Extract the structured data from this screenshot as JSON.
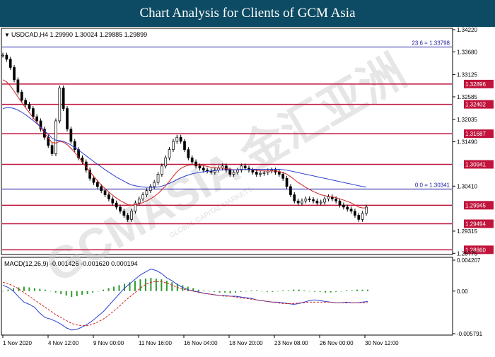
{
  "banner": {
    "title": "Chart Analysis for Clients of GCM Asia"
  },
  "chart_header": {
    "symbol_line": "USDCAD,H4  1.29990 1.30024 1.29885 1.29899",
    "menu_icon": "triangle-down-icon"
  },
  "macd_header": {
    "text": "MACD(12,26,9) -0.001426 -0.001620 0.000194"
  },
  "watermark": {
    "text": "GCMASIA 金汇亚洲",
    "subtext": "GLOBAL CAPITAL MARKETS"
  },
  "chart_data": [
    {
      "type": "candlestick",
      "title": "USDCAD,H4",
      "ylim": [
        1.2878,
        1.3422
      ],
      "y_ticks": [
        "1.34220",
        "1.33680",
        "1.33125",
        "1.32585",
        "1.32035",
        "1.31490",
        "1.30410",
        "1.29315",
        "1.28775"
      ],
      "x_ticks": [
        "1 Nov 2020",
        "4 Nov 12:00",
        "9 Nov 00:00",
        "11 Nov 16:00",
        "16 Nov 04:00",
        "18 Nov 20:00",
        "23 Nov 08:00",
        "26 Nov 00:00",
        "30 Nov 12:00"
      ],
      "levels": [
        {
          "label": "1.32896",
          "value": 1.32896,
          "color": "#c0143c"
        },
        {
          "label": "1.32402",
          "value": 1.32402,
          "color": "#c0143c"
        },
        {
          "label": "1.31687",
          "value": 1.31687,
          "color": "#c0143c"
        },
        {
          "label": "1.30941",
          "value": 1.30941,
          "color": "#c0143c"
        },
        {
          "label": "1.29945",
          "value": 1.29945,
          "color": "#c0143c"
        },
        {
          "label": "1.29494",
          "value": 1.29494,
          "color": "#c0143c"
        },
        {
          "label": "1.28860",
          "value": 1.2886,
          "color": "#c0143c"
        }
      ],
      "fib_lines": [
        {
          "label": "23.6 = 1.33798",
          "value": 1.33798,
          "color": "#1a1aa0"
        },
        {
          "label": "0.0 = 1.30341",
          "value": 1.30341,
          "color": "#1a1aa0"
        }
      ],
      "series": [
        {
          "name": "price",
          "color": "#000000",
          "values": [
            1.336,
            1.335,
            1.333,
            1.33,
            1.327,
            1.325,
            1.324,
            1.323,
            1.321,
            1.32,
            1.318,
            1.316,
            1.314,
            1.312,
            1.32,
            1.328,
            1.323,
            1.318,
            1.315,
            1.313,
            1.311,
            1.31,
            1.308,
            1.306,
            1.305,
            1.304,
            1.303,
            1.302,
            1.301,
            1.3,
            1.299,
            1.298,
            1.297,
            1.296,
            1.298,
            1.3,
            1.301,
            1.302,
            1.303,
            1.304,
            1.305,
            1.307,
            1.309,
            1.311,
            1.313,
            1.315,
            1.316,
            1.315,
            1.313,
            1.311,
            1.31,
            1.309,
            1.3085,
            1.308,
            1.3078,
            1.3075,
            1.308,
            1.3085,
            1.309,
            1.308,
            1.307,
            1.3075,
            1.308,
            1.309,
            1.3085,
            1.308,
            1.3075,
            1.307,
            1.3072,
            1.3074,
            1.3078,
            1.308,
            1.3075,
            1.307,
            1.306,
            1.304,
            1.302,
            1.3005,
            1.3,
            1.3005,
            1.301,
            1.3008,
            1.3005,
            1.3,
            1.3002,
            1.301,
            1.3015,
            1.301,
            1.3005,
            1.2995,
            1.299,
            1.2985,
            1.298,
            1.297,
            1.296,
            1.2975,
            1.299
          ]
        },
        {
          "name": "ma-fast",
          "color": "#d42020",
          "values": [
            1.33,
            1.3295,
            1.3285,
            1.3272,
            1.3258,
            1.3245,
            1.3232,
            1.322,
            1.3208,
            1.3196,
            1.3183,
            1.317,
            1.3158,
            1.3147,
            1.3146,
            1.315,
            1.3148,
            1.3142,
            1.3133,
            1.3123,
            1.3112,
            1.31,
            1.3088,
            1.3076,
            1.3065,
            1.3054,
            1.3044,
            1.3035,
            1.3027,
            1.3019,
            1.3012,
            1.3006,
            1.3001,
            1.2996,
            1.2995,
            1.2996,
            1.2998,
            1.3001,
            1.3005,
            1.301,
            1.3016,
            1.3023,
            1.3032,
            1.3042,
            1.3053,
            1.3065,
            1.3076,
            1.3084,
            1.3089,
            1.3092,
            1.3093,
            1.3093,
            1.3092,
            1.3091,
            1.3089,
            1.3087,
            1.3086,
            1.3085,
            1.3085,
            1.3084,
            1.3082,
            1.3081,
            1.3081,
            1.3082,
            1.3082,
            1.3082,
            1.3081,
            1.308,
            1.3079,
            1.3078,
            1.3078,
            1.3078,
            1.3078,
            1.3077,
            1.3074,
            1.307,
            1.3064,
            1.3057,
            1.305,
            1.3044,
            1.3038,
            1.3033,
            1.3028,
            1.3024,
            1.302,
            1.3018,
            1.3016,
            1.3015,
            1.3013,
            1.301,
            1.3007,
            1.3004,
            1.3,
            1.2995,
            1.299,
            1.2988,
            1.2988
          ]
        },
        {
          "name": "ma-slow",
          "color": "#2a3fd0",
          "values": [
            1.323,
            1.3232,
            1.3232,
            1.323,
            1.3226,
            1.3221,
            1.3215,
            1.3208,
            1.3201,
            1.3193,
            1.3185,
            1.3176,
            1.3167,
            1.3158,
            1.3153,
            1.3152,
            1.315,
            1.3146,
            1.3141,
            1.3135,
            1.3129,
            1.3122,
            1.3115,
            1.3108,
            1.3101,
            1.3094,
            1.3088,
            1.3081,
            1.3075,
            1.3069,
            1.3063,
            1.3058,
            1.3053,
            1.3048,
            1.3044,
            1.3042,
            1.304,
            1.3039,
            1.3038,
            1.3038,
            1.3038,
            1.3039,
            1.3041,
            1.3044,
            1.3048,
            1.3052,
            1.3057,
            1.3061,
            1.3065,
            1.3068,
            1.3071,
            1.3073,
            1.3075,
            1.3076,
            1.3077,
            1.3078,
            1.3079,
            1.308,
            1.3081,
            1.3081,
            1.3081,
            1.3081,
            1.3081,
            1.3082,
            1.3082,
            1.3082,
            1.3082,
            1.3082,
            1.3082,
            1.3082,
            1.3082,
            1.3082,
            1.3082,
            1.3082,
            1.3081,
            1.308,
            1.3078,
            1.3076,
            1.3074,
            1.3072,
            1.307,
            1.3068,
            1.3066,
            1.3064,
            1.3062,
            1.306,
            1.3058,
            1.3056,
            1.3054,
            1.3052,
            1.305,
            1.3048,
            1.3046,
            1.3044,
            1.3042,
            1.304,
            1.3039
          ]
        }
      ]
    },
    {
      "type": "bar",
      "title": "MACD(12,26,9)",
      "ylim": [
        -0.005791,
        0.004207
      ],
      "y_ticks": [
        "0.004207",
        "0.00",
        "-0.005791"
      ],
      "series": [
        {
          "name": "histogram",
          "color": "#2e9a2e",
          "values": [
            0.0,
            0.0002,
            0.0004,
            0.0005,
            0.0006,
            0.0005,
            0.0004,
            0.0003,
            0.0002,
            0.0,
            -0.0002,
            -0.0004,
            -0.0006,
            -0.0008,
            -0.0007,
            -0.0005,
            -0.0004,
            -0.0002,
            0.0,
            0.0002,
            0.0004,
            0.0006,
            0.0008,
            0.001,
            0.0012,
            0.0014,
            0.0016,
            0.0017,
            0.0018,
            0.0017,
            0.0016,
            0.0014,
            0.0012,
            0.001,
            0.0008,
            0.0006,
            0.0004,
            0.0002,
            0.0001,
            0.0,
            -0.0001,
            -0.0002,
            -0.0002,
            -0.0003,
            -0.0002,
            -0.0001,
            0.0,
            0.0001,
            0.0001,
            0.0,
            -0.0001,
            -0.0001,
            0.0,
            0.0001,
            0.0001,
            0.0002,
            0.0002,
            0.0001,
            0.0,
            -0.0001,
            -0.0001,
            -0.0002,
            -0.0002,
            -0.0001,
            0.0,
            0.0001,
            0.0001,
            0.0002,
            0.0002,
            0.0002
          ]
        },
        {
          "name": "macd",
          "color": "#2a3fd0",
          "values": [
            0.0008,
            0.0005,
            0.0,
            -0.0008,
            -0.0015,
            -0.0018,
            -0.0022,
            -0.003,
            -0.0036,
            -0.0038,
            -0.0041,
            -0.0045,
            -0.005,
            -0.0053,
            -0.0052,
            -0.0049,
            -0.0045,
            -0.004,
            -0.0034,
            -0.0028,
            -0.002,
            -0.0012,
            -0.0004,
            0.0004,
            0.001,
            0.0016,
            0.0022,
            0.0026,
            0.003,
            0.0028,
            0.0024,
            0.0018,
            0.0014,
            0.0009,
            0.0005,
            0.0002,
            0.0,
            -0.0001,
            -0.0003,
            -0.0004,
            -0.0005,
            -0.0006,
            -0.0006,
            -0.0007,
            -0.0007,
            -0.0008,
            -0.0009,
            -0.001,
            -0.0012,
            -0.0013,
            -0.0014,
            -0.0015,
            -0.0015,
            -0.0016,
            -0.0017,
            -0.0018,
            -0.0017,
            -0.0015,
            -0.0013,
            -0.0012,
            -0.0013,
            -0.0014,
            -0.0015,
            -0.0016,
            -0.0016,
            -0.0015,
            -0.0016,
            -0.0016,
            -0.0015,
            -0.0014
          ]
        },
        {
          "name": "signal",
          "color": "#d42020",
          "values": [
            0.0012,
            0.001,
            0.0007,
            0.0003,
            -0.0002,
            -0.0007,
            -0.0012,
            -0.0017,
            -0.0022,
            -0.0027,
            -0.0032,
            -0.0036,
            -0.004,
            -0.0044,
            -0.0046,
            -0.0047,
            -0.0047,
            -0.0045,
            -0.0042,
            -0.0038,
            -0.0033,
            -0.0027,
            -0.0021,
            -0.0014,
            -0.0008,
            -0.0002,
            0.0004,
            0.0009,
            0.0012,
            0.0013,
            0.0013,
            0.0011,
            0.0008,
            0.0005,
            0.0003,
            0.0001,
            0.0,
            -0.0002,
            -0.0003,
            -0.0004,
            -0.0005,
            -0.0006,
            -0.0007,
            -0.0007,
            -0.0008,
            -0.0009,
            -0.001,
            -0.0011,
            -0.0012,
            -0.0013,
            -0.0014,
            -0.0015,
            -0.0016,
            -0.0017,
            -0.0017,
            -0.0017,
            -0.0016,
            -0.0016,
            -0.0015,
            -0.0015,
            -0.0015,
            -0.0015,
            -0.0015,
            -0.0016,
            -0.0016,
            -0.0016,
            -0.0016,
            -0.0016,
            -0.0016,
            -0.0016
          ]
        }
      ]
    }
  ]
}
